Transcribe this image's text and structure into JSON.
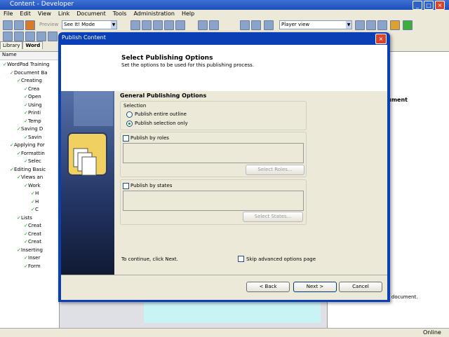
{
  "window": {
    "title": "Content - Developer",
    "controls": [
      "_",
      "□",
      "×"
    ]
  },
  "menu": [
    "File",
    "Edit",
    "View",
    "Link",
    "Document",
    "Tools",
    "Administration",
    "Help"
  ],
  "toolbar": {
    "preview_label": "Preview",
    "mode_value": "See It! Mode",
    "view_value": "Player view"
  },
  "left_pane": {
    "tabs": [
      "Library",
      "Word"
    ],
    "column_header": "Name",
    "tree": [
      {
        "label": "WordPad Training",
        "depth": 0
      },
      {
        "label": "Document Ba",
        "depth": 1
      },
      {
        "label": "Creating",
        "depth": 2
      },
      {
        "label": "Crea",
        "depth": 3
      },
      {
        "label": "Open",
        "depth": 3
      },
      {
        "label": "Using",
        "depth": 3
      },
      {
        "label": "Printi",
        "depth": 3
      },
      {
        "label": "Temp",
        "depth": 3
      },
      {
        "label": "Saving D",
        "depth": 2
      },
      {
        "label": "Savin",
        "depth": 3
      },
      {
        "label": "Applying For",
        "depth": 1
      },
      {
        "label": "Formattin",
        "depth": 2
      },
      {
        "label": "Selec",
        "depth": 3
      },
      {
        "label": "Editing Basic",
        "depth": 1
      },
      {
        "label": "Views an",
        "depth": 2
      },
      {
        "label": "Work",
        "depth": 3
      },
      {
        "label": "H",
        "depth": 4
      },
      {
        "label": "H",
        "depth": 4
      },
      {
        "label": "C",
        "depth": 4
      },
      {
        "label": "Lists",
        "depth": 2
      },
      {
        "label": "Creat",
        "depth": 3
      },
      {
        "label": "Creat",
        "depth": 3
      },
      {
        "label": "Creat",
        "depth": 3
      },
      {
        "label": "Inserting",
        "depth": 2
      },
      {
        "label": "Inser",
        "depth": 3
      },
      {
        "label": "Form",
        "depth": 3
      }
    ]
  },
  "right_pane": {
    "heading_fragment": "ument",
    "text_fragment": "s document."
  },
  "status": {
    "text": "Online"
  },
  "dialog": {
    "title": "Publish Content",
    "close": "×",
    "header_title": "Select Publishing Options",
    "header_subtitle": "Set the options to be used for this publishing process.",
    "section_title": "General Publishing Options",
    "selection_label": "Selection",
    "radio_entire": "Publish entire outline",
    "radio_selection": "Publish selection only",
    "selected_radio": "selection",
    "roles_label": "Publish by roles",
    "roles_checked": false,
    "select_roles_button": "Select Roles...",
    "states_label": "Publish by states",
    "states_checked": false,
    "select_states_button": "Select States...",
    "continue_text": "To continue, click Next.",
    "skip_label": "Skip advanced options page",
    "skip_checked": false,
    "back_button": "< Back",
    "next_button": "Next >",
    "cancel_button": "Cancel"
  },
  "colors": {
    "dialog_frame": "#0a3fb5",
    "titlebar": "#1c4fb8",
    "face": "#ece9d8",
    "check_green": "#1c9d1c"
  }
}
